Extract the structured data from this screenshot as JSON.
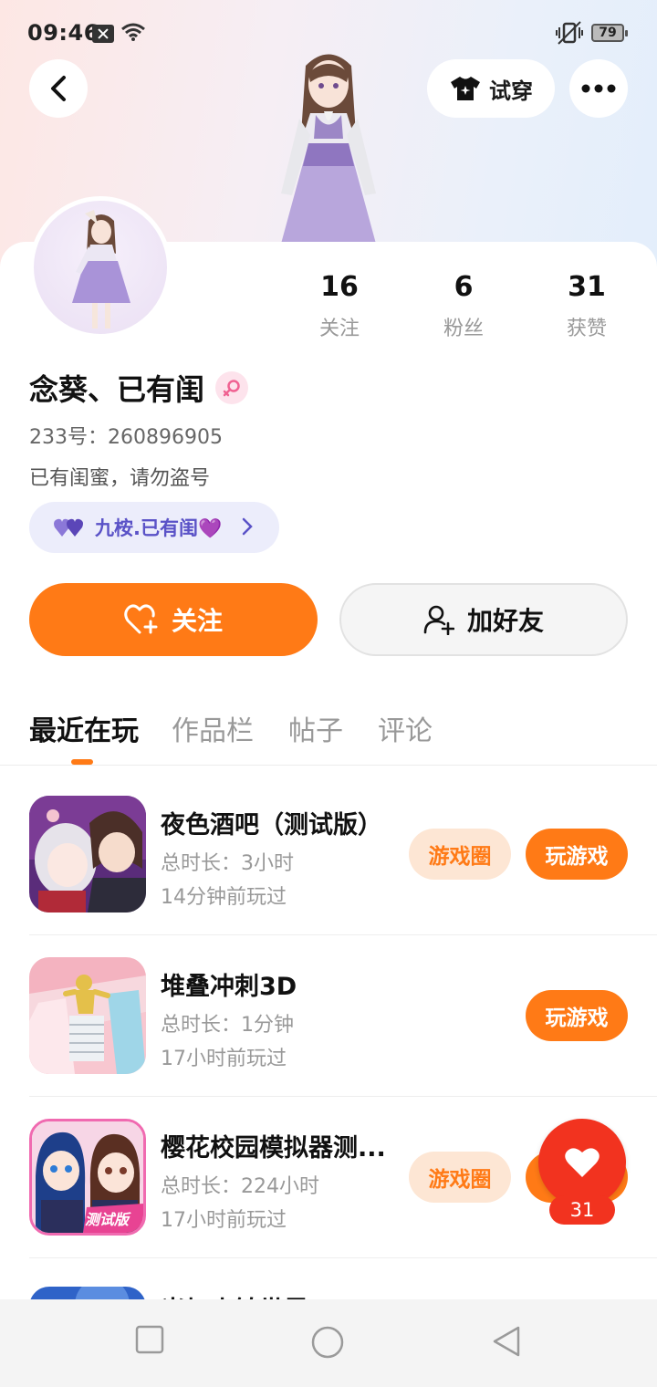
{
  "status_bar": {
    "time": "09:46",
    "battery": "79"
  },
  "header": {
    "try_on_label": "试穿"
  },
  "stats": [
    {
      "value": "16",
      "label": "关注"
    },
    {
      "value": "6",
      "label": "粉丝"
    },
    {
      "value": "31",
      "label": "获赞"
    }
  ],
  "profile": {
    "name": "念葵、已有闺",
    "uid": "233号：260896905",
    "bio": "已有闺蜜，请勿盗号",
    "tag": "九桉.已有闺💜"
  },
  "actions": {
    "follow": "关注",
    "add_friend": "加好友"
  },
  "tabs": [
    "最近在玩",
    "作品栏",
    "帖子",
    "评论"
  ],
  "games": [
    {
      "title": "夜色酒吧（测试版）",
      "duration": "总时长：3小时",
      "last_played": "14分钟前玩过",
      "circle_label": "游戏圈",
      "play_label": "玩游戏"
    },
    {
      "title": "堆叠冲刺3D",
      "duration": "总时长：1分钟",
      "last_played": "17小时前玩过",
      "play_label": "玩游戏"
    },
    {
      "title": "樱花校园模拟器测...",
      "duration": "总时长：224小时",
      "last_played": "17小时前玩过",
      "circle_label": "游戏圈",
      "icon_badge": "测试版"
    },
    {
      "title": "米加小镇世界"
    }
  ],
  "like_float": {
    "count": "31"
  },
  "colors": {
    "accent": "#ff7a16",
    "like": "#f2331f",
    "tag_text": "#5a52c7"
  }
}
